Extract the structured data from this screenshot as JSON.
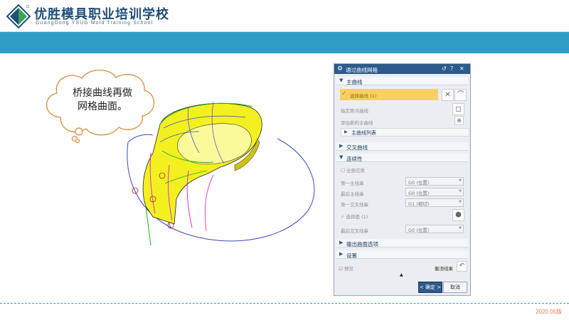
{
  "header": {
    "school_name": "优胜模具职业培训学校",
    "school_name_en": "GuangDong YSUG Mold Training School"
  },
  "callout": {
    "line1": "桥接曲线再做",
    "line2": "网格曲面。"
  },
  "dialog": {
    "title": "通过曲线网格",
    "section_primary": "主曲线",
    "select_curve": "选择曲线 (1)",
    "specify_origin_curve": "指定原点曲线",
    "add_new_primary": "添加新的主曲线",
    "primary_list": "主曲线列表",
    "section_cross": "交叉曲线",
    "section_continuity": "连续性",
    "apply_all": "全部应用",
    "first_primary": "第一主线串",
    "last_primary": "最后主线串",
    "first_cross": "第一交叉线串",
    "select_face": "选择面 (1)",
    "last_cross": "最后交叉线串",
    "first_primary_value": "G0 (位置)",
    "last_primary_value": "G0 (位置)",
    "first_cross_value": "G1 (相切)",
    "last_cross_value": "G0 (位置)",
    "section_output": "输出曲面选项",
    "section_settings": "设置",
    "preview": "预览",
    "undo_result": "撤消结果",
    "ok": "< 确定 >",
    "cancel": "取消"
  },
  "footer": {
    "version": "2020.05版"
  }
}
